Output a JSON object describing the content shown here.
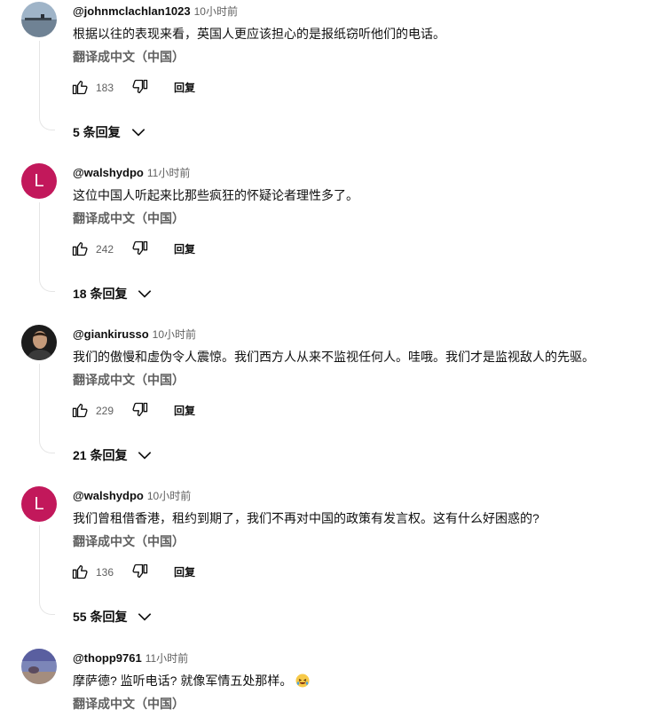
{
  "comments": [
    {
      "author": "@johnmclachlan1023",
      "time": "10小时前",
      "text": "根据以往的表现来看，英国人更应该担心的是报纸窃听他们的电话。",
      "translate": "翻译成中文（中国）",
      "likes": "183",
      "reply": "回复",
      "replies": "5 条回复",
      "avatar_icon": "landscape-photo-avatar"
    },
    {
      "author": "@walshydpo",
      "time": "11小时前",
      "text": "这位中国人听起来比那些疯狂的怀疑论者理性多了。",
      "translate": "翻译成中文（中国）",
      "likes": "242",
      "reply": "回复",
      "replies": "18 条回复",
      "avatar_letter": "L",
      "avatar_color": "#c2185b"
    },
    {
      "author": "@giankirusso",
      "time": "10小时前",
      "text": "我们的傲慢和虚伪令人震惊。我们西方人从来不监视任何人。哇哦。我们才是监视敌人的先驱。",
      "translate": "翻译成中文（中国）",
      "likes": "229",
      "reply": "回复",
      "replies": "21 条回复",
      "avatar_icon": "person-photo-avatar"
    },
    {
      "author": "@walshydpo",
      "time": "10小时前",
      "text": "我们曾租借香港，租约到期了，我们不再对中国的政策有发言权。这有什么好困惑的?",
      "translate": "翻译成中文（中国）",
      "likes": "136",
      "reply": "回复",
      "replies": "55 条回复",
      "avatar_letter": "L",
      "avatar_color": "#c2185b"
    },
    {
      "author": "@thopp9761",
      "time": "11小时前",
      "text": "摩萨德? 监听电话? 就像军情五处那样。",
      "emoji": "laughing-face-emoji",
      "translate": "翻译成中文（中国）",
      "avatar_icon": "sky-photo-avatar"
    }
  ]
}
